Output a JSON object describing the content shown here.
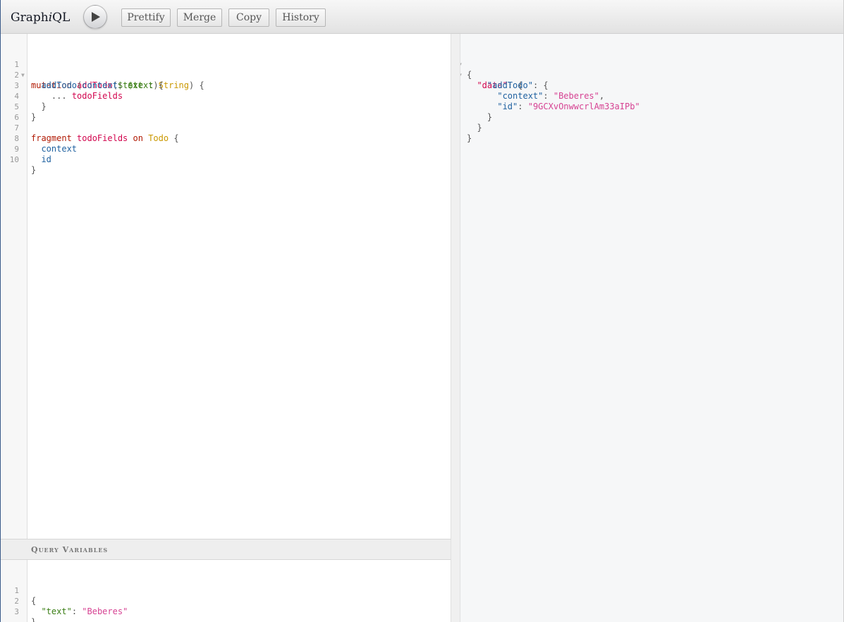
{
  "toolbar": {
    "logo_prefix": "Graph",
    "logo_italic": "i",
    "logo_suffix": "QL",
    "run_icon": "play-icon",
    "buttons": [
      "Prettify",
      "Merge",
      "Copy",
      "History"
    ]
  },
  "query": {
    "line_numbers": [
      "1",
      "2",
      "3",
      "4",
      "5",
      "6",
      "7",
      "8",
      "9",
      "10"
    ],
    "l1": {
      "kw": "mutation",
      "name": "addTodo",
      "p1": "(",
      "var": "$text",
      "p2": " : ",
      "type": "String",
      "p3": ") {"
    },
    "l2": {
      "field": "addTodo",
      "p1": "(",
      "arg": "context",
      "p2": ": ",
      "var": "$text",
      "p3": "){"
    },
    "l3": {
      "spread": "...",
      "name": "todoFields"
    },
    "l4": "}",
    "l5": "}",
    "l7": {
      "kw": "fragment",
      "name": "todoFields",
      "on": "on",
      "type": "Todo",
      "p": " {"
    },
    "l8": "context",
    "l9": "id",
    "l10": "}"
  },
  "variables": {
    "title": "Query Variables",
    "line_numbers": [
      "1",
      "2",
      "3"
    ],
    "l1": "{",
    "key": "\"text\"",
    "colon": ": ",
    "value": "\"Beberes\"",
    "l3": "}"
  },
  "result": {
    "l1": "{",
    "data_key": "\"data\"",
    "colon": ": ",
    "open": "{",
    "addTodo_key": "\"addTodo\"",
    "context_key": "\"context\"",
    "context_value": "\"Beberes\"",
    "comma": ",",
    "id_key": "\"id\"",
    "id_value": "\"9GCXvOnwwcrlAm33aIPb\"",
    "close": "}"
  },
  "colors": {
    "keyword": "#b11a04",
    "definition": "#d2054e",
    "variable": "#397d13",
    "type": "#ca9800",
    "property": "#1f61a0",
    "string": "#d64292"
  }
}
